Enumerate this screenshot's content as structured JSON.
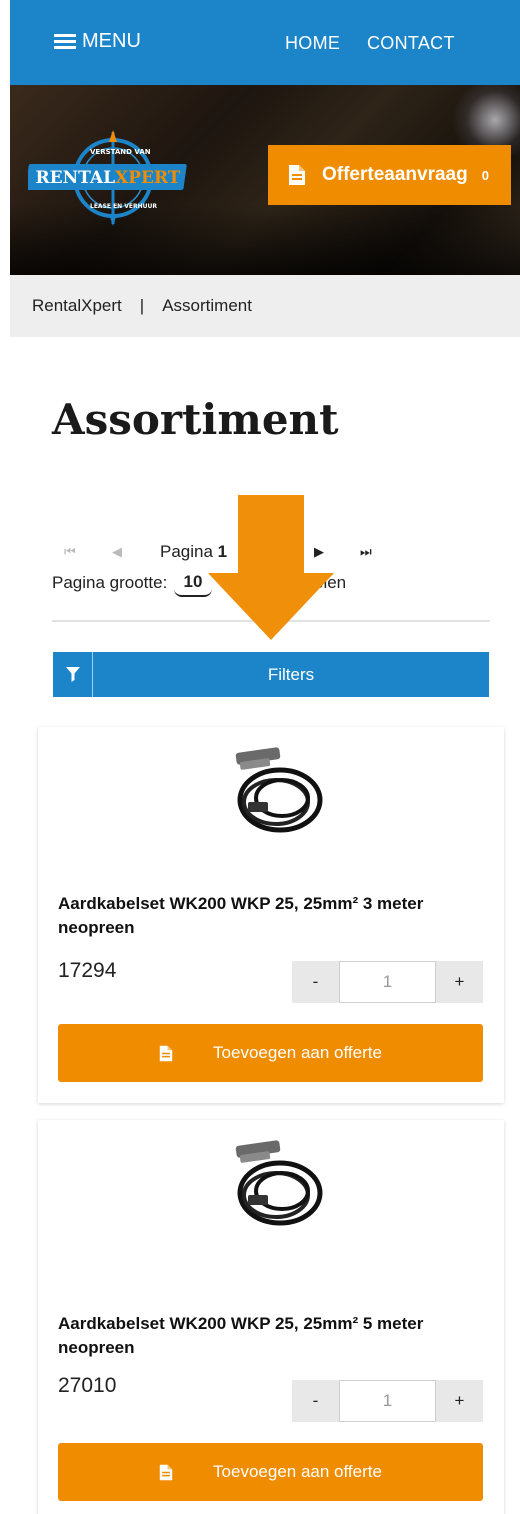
{
  "header": {
    "menu_label": "MENU",
    "nav": [
      {
        "label": "HOME"
      },
      {
        "label": "CONTACT"
      }
    ]
  },
  "hero": {
    "logo_text": "RENTALXPERT",
    "logo_ring_top": "VERSTAND VAN",
    "logo_ring_bottom": "LEASE EN VERHUUR",
    "offerte_label": "Offerteaanvraag",
    "offerte_count": "0"
  },
  "breadcrumb": {
    "items": [
      "RentalXpert",
      "Assortiment"
    ],
    "separator": "|"
  },
  "page": {
    "title": "Assortiment"
  },
  "pager": {
    "page_text_prefix": "Pagina",
    "current_page": "1",
    "page_size_label": "Pagina grootte:",
    "page_size_value": "10",
    "items_suffix": "elen"
  },
  "filters": {
    "label": "Filters"
  },
  "products": [
    {
      "name": "Aardkabelset WK200 WKP 25, 25mm² 3 meter neopreen",
      "code": "17294",
      "quantity": "1",
      "minus": "-",
      "plus": "+",
      "add_label": "Toevoegen aan offerte"
    },
    {
      "name": "Aardkabelset WK200 WKP 25, 25mm² 5 meter neopreen",
      "code": "27010",
      "quantity": "1",
      "minus": "-",
      "plus": "+",
      "add_label": "Toevoegen aan offerte"
    }
  ],
  "colors": {
    "primary_blue": "#1c85c9",
    "accent_orange": "#f08c00",
    "arrow_orange": "#f0900a"
  }
}
